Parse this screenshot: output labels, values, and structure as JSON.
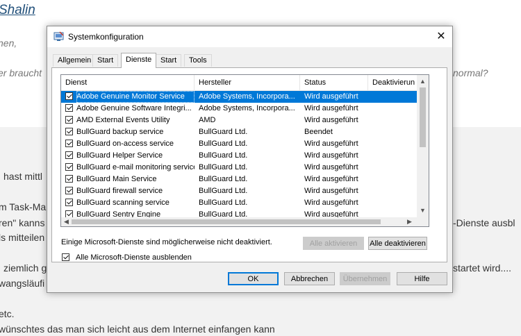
{
  "background_page": {
    "title": "Shalin",
    "lines": [
      "nen,",
      "er braucht",
      "normal?",
      "hast mittl",
      "m Task-Ma",
      "ren\" kanns",
      "-Dienste ausbl",
      "ls mitteilen",
      "ziemlich g",
      "startet wird....",
      "wangsläufi",
      "etc.",
      "wünschtes das man sich leicht aus dem Internet einfangen kann"
    ]
  },
  "dialog": {
    "title": "Systemkonfiguration",
    "close_glyph": "✕",
    "tabs": [
      "Allgemein",
      "Start",
      "Dienste",
      "Start",
      "Tools"
    ],
    "active_tab": "Dienste",
    "columns": [
      "Dienst",
      "Hersteller",
      "Status",
      "Deaktivierun"
    ],
    "services": [
      {
        "name": "Adobe Genuine Monitor Service",
        "manufacturer": "Adobe Systems, Incorpora...",
        "status": "Wird ausgeführt",
        "checked": true,
        "selected": true
      },
      {
        "name": "Adobe Genuine Software Integri...",
        "manufacturer": "Adobe Systems, Incorpora...",
        "status": "Wird ausgeführt",
        "checked": true
      },
      {
        "name": "AMD External Events Utility",
        "manufacturer": "AMD",
        "status": "Wird ausgeführt",
        "checked": true
      },
      {
        "name": "BullGuard backup service",
        "manufacturer": "BullGuard Ltd.",
        "status": "Beendet",
        "checked": true
      },
      {
        "name": "BullGuard on-access service",
        "manufacturer": "BullGuard Ltd.",
        "status": "Wird ausgeführt",
        "checked": true
      },
      {
        "name": "BullGuard Helper Service",
        "manufacturer": "BullGuard Ltd.",
        "status": "Wird ausgeführt",
        "checked": true
      },
      {
        "name": "BullGuard e-mail monitoring service",
        "manufacturer": "BullGuard Ltd.",
        "status": "Wird ausgeführt",
        "checked": true
      },
      {
        "name": "BullGuard Main Service",
        "manufacturer": "BullGuard Ltd.",
        "status": "Wird ausgeführt",
        "checked": true
      },
      {
        "name": "BullGuard firewall service",
        "manufacturer": "BullGuard Ltd.",
        "status": "Wird ausgeführt",
        "checked": true
      },
      {
        "name": "BullGuard scanning service",
        "manufacturer": "BullGuard Ltd.",
        "status": "Wird ausgeführt",
        "checked": true
      },
      {
        "name": "BullGuard Sentry Engine",
        "manufacturer": "BullGuard Ltd.",
        "status": "Wird ausgeführt",
        "checked": true
      }
    ],
    "notice": "Einige Microsoft-Dienste sind möglicherweise nicht deaktiviert.",
    "enable_all": "Alle aktivieren",
    "disable_all": "Alle deaktivieren",
    "hide_ms_label": "Alle Microsoft-Dienste ausblenden",
    "hide_ms_checked": true,
    "buttons": {
      "ok": "OK",
      "cancel": "Abbrechen",
      "apply": "Übernehmen",
      "help": "Hilfe"
    }
  }
}
